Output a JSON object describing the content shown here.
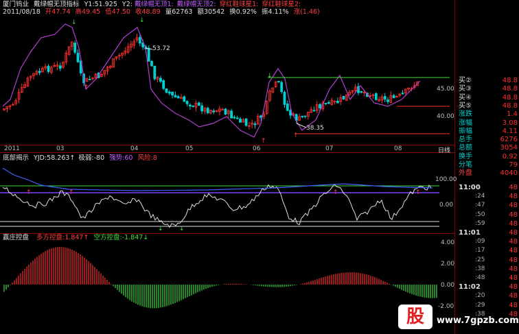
{
  "header": {
    "stock": "厦门钨业",
    "indicator": "戴绿帽无顶指标",
    "y1": "Y1:51.925",
    "y2": "Y2:",
    "legend_a": "戴绿帽无顶1:",
    "legend_b": "戴绿帽无顶2:",
    "legend_c": "穿红鞋球星1:",
    "legend_d": "穿红鞋球星2:",
    "date": "2011/08/18",
    "open": "开47.74",
    "high": "高49.45",
    "low": "低47.50",
    "close": "收48.89",
    "volume": "量62763",
    "amount": "额30542",
    "turnover": "换0.92%",
    "amplitude": "振4.11%",
    "change": "涨(1.46)"
  },
  "main_chart": {
    "y_ticks": [
      "45.00",
      "40.00"
    ],
    "annotations": [
      "53.72",
      "38.35"
    ],
    "x_ticks": [
      "2011",
      "03",
      "04",
      "05",
      "06",
      "07",
      "08"
    ],
    "period": "日线"
  },
  "indicator1": {
    "name": "底部揭示",
    "yjd": "YJD:58.263",
    "extreme_weak": "极弱:-80",
    "strong": "强势:60",
    "risk": "风险:8",
    "y_ticks": [
      "100.00",
      "0.00"
    ]
  },
  "indicator2": {
    "name": "赢庄控盘",
    "long": "多方控盘:1.847",
    "short": "空方控盘:-1.847",
    "y_ticks": [
      "4.00",
      "2.00",
      "0.00",
      "-2.00"
    ]
  },
  "side_panel": {
    "quotes": [
      {
        "label": "买②",
        "value": "48.8"
      },
      {
        "label": "买③",
        "value": "48.8"
      },
      {
        "label": "买④",
        "value": "48.8"
      },
      {
        "label": "买⑤",
        "value": "48.8"
      }
    ],
    "stats": [
      {
        "label": "涨跌",
        "value": "1.4"
      },
      {
        "label": "涨幅",
        "value": "3.08"
      },
      {
        "label": "振幅",
        "value": "4.11"
      },
      {
        "label": "总手",
        "value": "6276"
      },
      {
        "label": "总额",
        "value": "3054"
      },
      {
        "label": "换手",
        "value": "0.92"
      },
      {
        "label": "分笔",
        "value": "79"
      },
      {
        "label": "外盘",
        "value": "4040"
      }
    ],
    "ticks": [
      {
        "time": "11:00",
        "price": "48"
      },
      {
        "time": ":24",
        "price": "48"
      },
      {
        "time": ":47",
        "price": "48"
      },
      {
        "time": ":50",
        "price": "48"
      },
      {
        "time": ":59",
        "price": "48"
      },
      {
        "time": "11:01",
        "price": "48"
      },
      {
        "time": ":09",
        "price": "48"
      },
      {
        "time": ":17",
        "price": "48"
      },
      {
        "time": ":25",
        "price": "48"
      },
      {
        "time": ":38",
        "price": "48"
      },
      {
        "time": ":48",
        "price": "48"
      },
      {
        "time": "11:02",
        "price": "48"
      },
      {
        "time": ":20",
        "price": "48"
      },
      {
        "time": ":29",
        "price": "48"
      },
      {
        "time": ":38",
        "price": "48"
      }
    ]
  },
  "watermark": {
    "logo": "股",
    "url": "www.7gpzb.com"
  }
}
